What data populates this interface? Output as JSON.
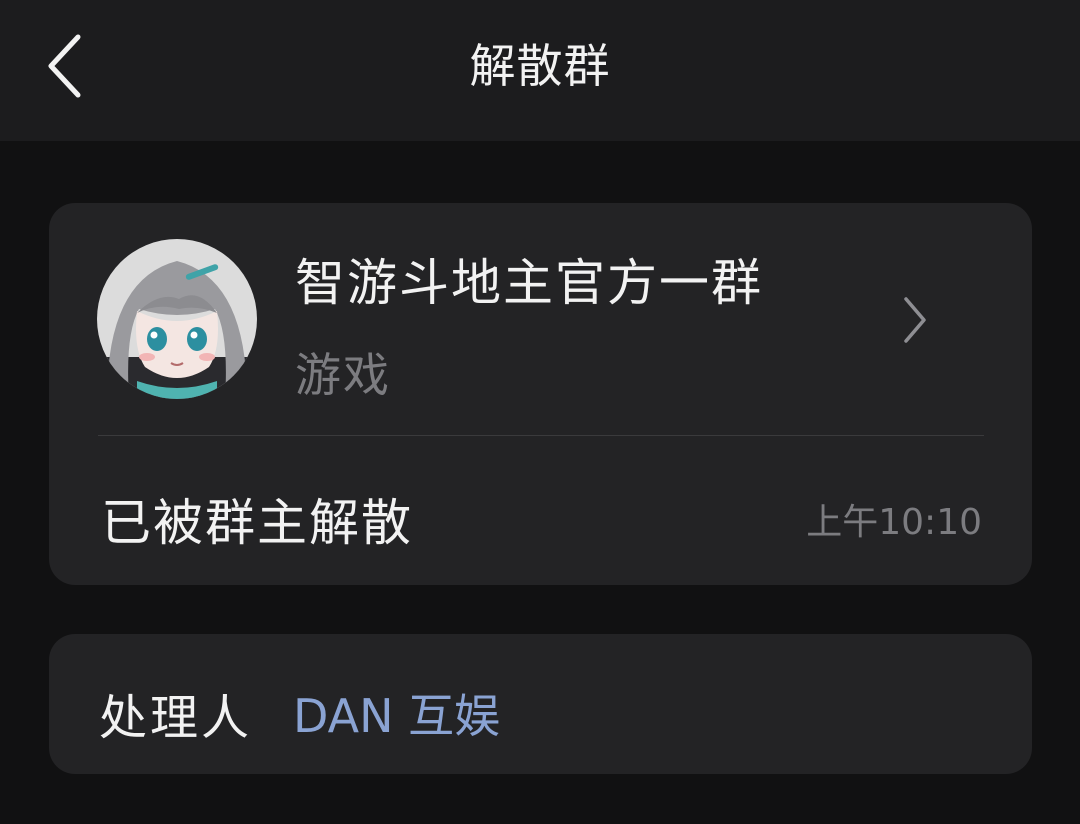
{
  "header": {
    "title": "解散群",
    "back_icon": "chevron-left-icon"
  },
  "group_card": {
    "name": "智游斗地主官方一群",
    "category": "游戏",
    "chevron_icon": "chevron-right-icon",
    "status": "已被群主解散",
    "time": "上午10:10"
  },
  "handler_card": {
    "label": "处理人",
    "value": "DAN 互娱"
  },
  "colors": {
    "background": "#111112",
    "header": "#1c1c1e",
    "card": "#232325",
    "primary_text": "#f2f2f2",
    "secondary_text": "#7c7c80",
    "link": "#8aa3d3"
  }
}
